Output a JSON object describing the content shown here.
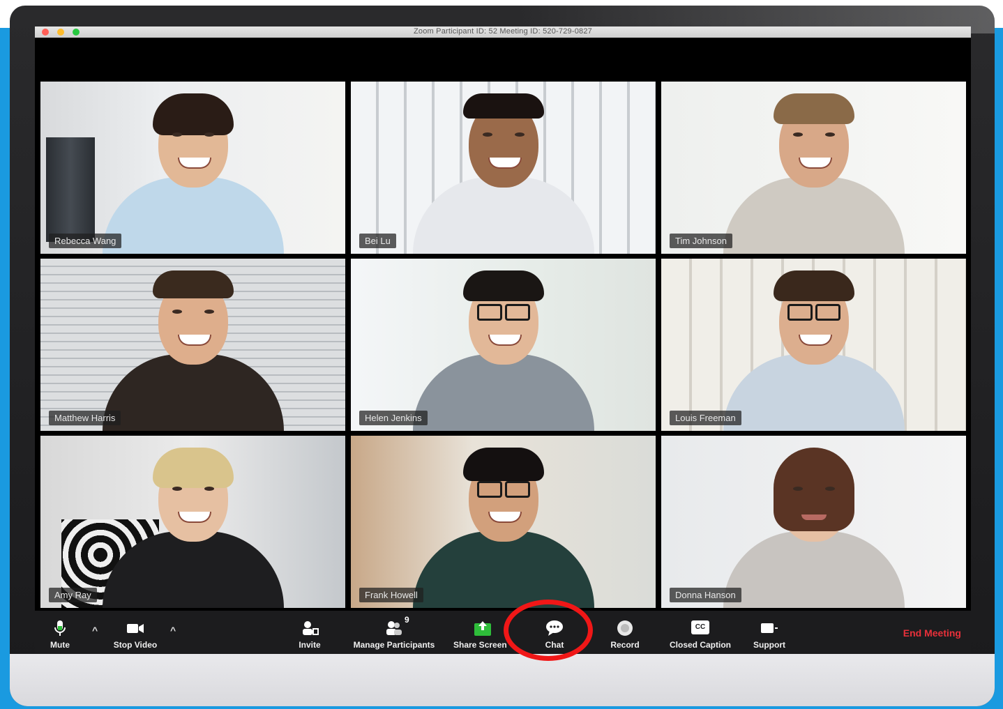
{
  "window": {
    "title": "Zoom Participant ID: 52   Meeting ID: 520-729-0827"
  },
  "participants": [
    {
      "name": "Rebecca Wang"
    },
    {
      "name": "Bei Lu"
    },
    {
      "name": "Tim Johnson"
    },
    {
      "name": "Matthew Harris"
    },
    {
      "name": "Helen Jenkins"
    },
    {
      "name": "Louis Freeman"
    },
    {
      "name": "Amy Ray"
    },
    {
      "name": "Frank Howell"
    },
    {
      "name": "Donna Hanson"
    }
  ],
  "toolbar": {
    "mute_label": "Mute",
    "video_label": "Stop Video",
    "invite_label": "Invite",
    "participants_label": "Manage Participants",
    "participants_count": "9",
    "share_label": "Share Screen",
    "chat_label": "Chat",
    "record_label": "Record",
    "cc_label": "Closed Caption",
    "support_label": "Support",
    "end_label": "End Meeting",
    "cc_icon_text": "CC"
  },
  "icons": {
    "mic": "microphone-icon",
    "video": "video-camera-icon",
    "invite": "invite-person-icon",
    "participants": "participants-icon",
    "share": "share-screen-icon",
    "chat": "chat-bubble-icon",
    "record": "record-icon",
    "cc": "closed-caption-icon",
    "support": "support-icon"
  },
  "colors": {
    "background_blue": "#1a9ae0",
    "share_green": "#2ebd3a",
    "end_meeting_red": "#e8303a",
    "highlight_red": "#f01717"
  }
}
